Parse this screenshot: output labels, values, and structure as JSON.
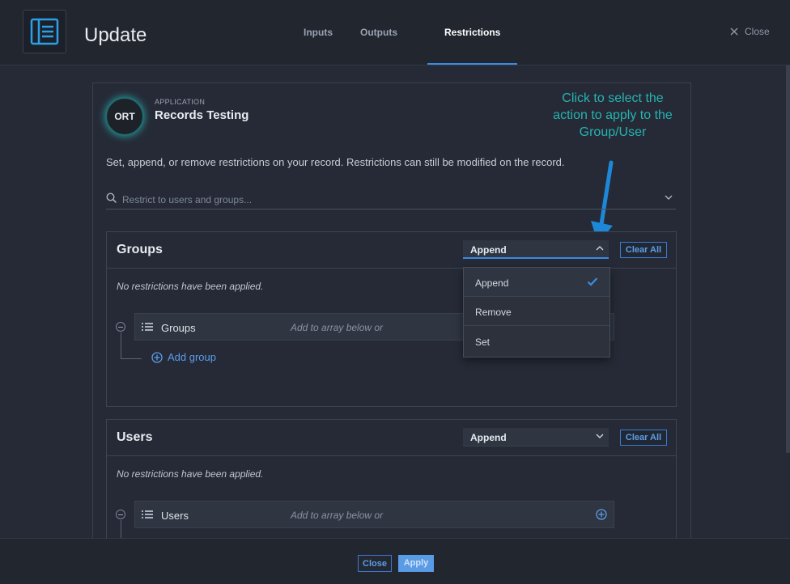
{
  "header": {
    "title": "Update",
    "tabs": [
      "Inputs",
      "Outputs",
      "Restrictions"
    ],
    "active_tab": "Restrictions",
    "close_label": "Close"
  },
  "application": {
    "badge": "ORT",
    "kicker": "APPLICATION",
    "name": "Records Testing"
  },
  "annotation": {
    "line1": "Click to select the",
    "line2": "action to apply to the",
    "line3": "Group/User"
  },
  "description": "Set, append, or remove restrictions on your record. Restrictions can still be modified on the record.",
  "search": {
    "placeholder": "Restrict to users and groups..."
  },
  "groups": {
    "title": "Groups",
    "action": "Append",
    "clear_label": "Clear All",
    "empty_text": "No restrictions have been applied.",
    "array_label": "Groups",
    "array_hint": "Add to array below or",
    "add_label": "Add group"
  },
  "dropdown": {
    "options": [
      "Append",
      "Remove",
      "Set"
    ],
    "selected": "Append"
  },
  "users": {
    "title": "Users",
    "action": "Append",
    "clear_label": "Clear All",
    "empty_text": "No restrictions have been applied.",
    "array_label": "Users",
    "array_hint": "Add to array below or"
  },
  "footer": {
    "close_label": "Close",
    "apply_label": "Apply"
  },
  "colors": {
    "accent": "#3b8be0",
    "annotation": "#26b3b1",
    "background": "#252a36"
  }
}
